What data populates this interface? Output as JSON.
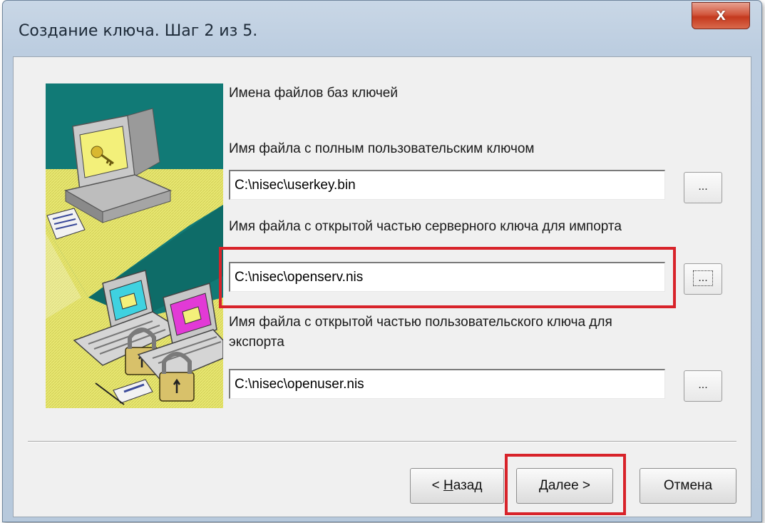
{
  "window": {
    "title": "Создание ключа. Шаг 2 из 5.",
    "close_glyph": "x"
  },
  "main": {
    "heading": "Имена файлов баз ключей",
    "fields": [
      {
        "label_lines": [
          "Имя файла с полным пользовательским ключом"
        ],
        "value": "C:\\nisec\\userkey.bin",
        "browse_label": "..."
      },
      {
        "label_lines": [
          "Имя файла с открытой частью серверного ключа для импорта"
        ],
        "value": "C:\\nisec\\openserv.nis",
        "browse_label": "..."
      },
      {
        "label_lines": [
          "Имя файла с открытой частью пользовательского ключа для",
          "экспорта"
        ],
        "value": "C:\\nisec\\openuser.nis",
        "browse_label": "..."
      }
    ]
  },
  "buttons": {
    "back": {
      "accel": "Н",
      "rest": "азад",
      "prefix": "< "
    },
    "next": {
      "accel": "Д",
      "rest": "алее >"
    },
    "cancel": "Отмена"
  },
  "colors": {
    "highlight": "#d8232a",
    "illustration_teal": "#117a76",
    "illustration_yellow": "#e8e774"
  },
  "icons": [
    "close-icon",
    "computer-key-icon",
    "laptop-padlock-icon",
    "document-icon"
  ]
}
